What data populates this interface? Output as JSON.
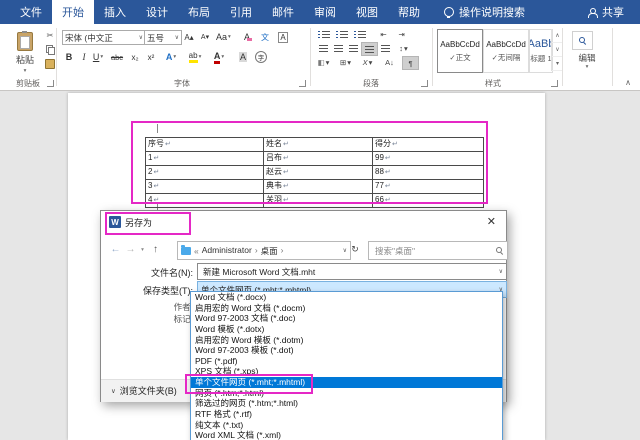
{
  "colors": {
    "word_blue": "#2b579a",
    "selection_blue": "#0078d7",
    "annotation_pink": "#e528c6",
    "savetype_fill": "#cce8ff",
    "doc_gray": "#e6e6e6"
  },
  "icons": {
    "word_logo": "W",
    "scissors": "✂",
    "bold": "B",
    "italic": "I",
    "underline": "U",
    "strikethrough": "abc",
    "subscript": "x₂",
    "superscript": "x²",
    "grow_font": "A▴",
    "shrink_font": "A▾",
    "change_case": "Aa",
    "clear_formatting": "A",
    "phonetic_guide": "文",
    "character_border": "A",
    "text_effects": "A",
    "highlight": "ab",
    "font_color": "A",
    "character_shading": "A",
    "enclose_character": "字",
    "indent_decrease": "⇤",
    "indent_increase": "⇥",
    "line_spacing": "↕",
    "shading": "◧",
    "borders": "⊞",
    "asian_layout": "X",
    "sort": "A↓",
    "pilcrow": "¶",
    "dropdown": "▾",
    "chevron": "∨",
    "back": "←",
    "forward": "→",
    "up": "↑",
    "refresh": "↻",
    "close": "✕",
    "collapse": "∧",
    "scroll_up": "∧",
    "scroll_down": "∨",
    "styles_more": "▾",
    "breadcrumb_sep": "›",
    "breadcrumb_prefix": "«"
  },
  "menu": {
    "tabs": [
      "文件",
      "开始",
      "插入",
      "设计",
      "布局",
      "引用",
      "邮件",
      "审阅",
      "视图",
      "帮助"
    ],
    "active_tab": "开始",
    "search_label": "操作说明搜索",
    "share_label": "共享"
  },
  "ribbon": {
    "paste_label": "粘贴",
    "font_name": "宋体 (中文正",
    "font_size": "五号",
    "group_labels": {
      "clipboard": "剪贴板",
      "font": "字体",
      "paragraph": "段落",
      "styles": "样式"
    },
    "styles": [
      {
        "sample": "AaBbCcDd",
        "name": "✓正文"
      },
      {
        "sample": "AaBbCcDd",
        "name": "✓无间隔"
      },
      {
        "sample": "AaBb",
        "name": "标题 1"
      }
    ],
    "selected_style_index": 0,
    "editing_label": "编辑"
  },
  "document": {
    "table": {
      "headers": [
        "序号",
        "姓名",
        "得分"
      ],
      "rows": [
        [
          "1",
          "吕布",
          "99"
        ],
        [
          "2",
          "赵云",
          "88"
        ],
        [
          "3",
          "典韦",
          "77"
        ],
        [
          "4",
          "关羽",
          "66"
        ]
      ],
      "cell_mark": "↵"
    }
  },
  "save_dialog": {
    "title": "另存为",
    "nav": {
      "breadcrumb": [
        "Administrator",
        "桌面"
      ],
      "search_placeholder": "搜索\"桌面\""
    },
    "filename_label": "文件名(N):",
    "filename_value": "新建 Microsoft Word 文档.mht",
    "savetype_label": "保存类型(T):",
    "savetype_value": "单个文件网页 (*.mht;*.mhtml)",
    "author_label": "作者:",
    "tags_label": "标记:",
    "browse_label": "浏览文件夹(B)",
    "filetype_options": [
      "Word 文档 (*.docx)",
      "启用宏的 Word 文档 (*.docm)",
      "Word 97-2003 文档 (*.doc)",
      "Word 模板 (*.dotx)",
      "启用宏的 Word 模板 (*.dotm)",
      "Word 97-2003 模板 (*.dot)",
      "PDF (*.pdf)",
      "XPS 文档 (*.xps)",
      "单个文件网页 (*.mht;*.mhtml)",
      "网页 (*.htm;*.html)",
      "筛选过的网页 (*.htm;*.html)",
      "RTF 格式 (*.rtf)",
      "纯文本 (*.txt)",
      "Word XML 文档 (*.xml)"
    ],
    "selected_option_index": 8
  }
}
